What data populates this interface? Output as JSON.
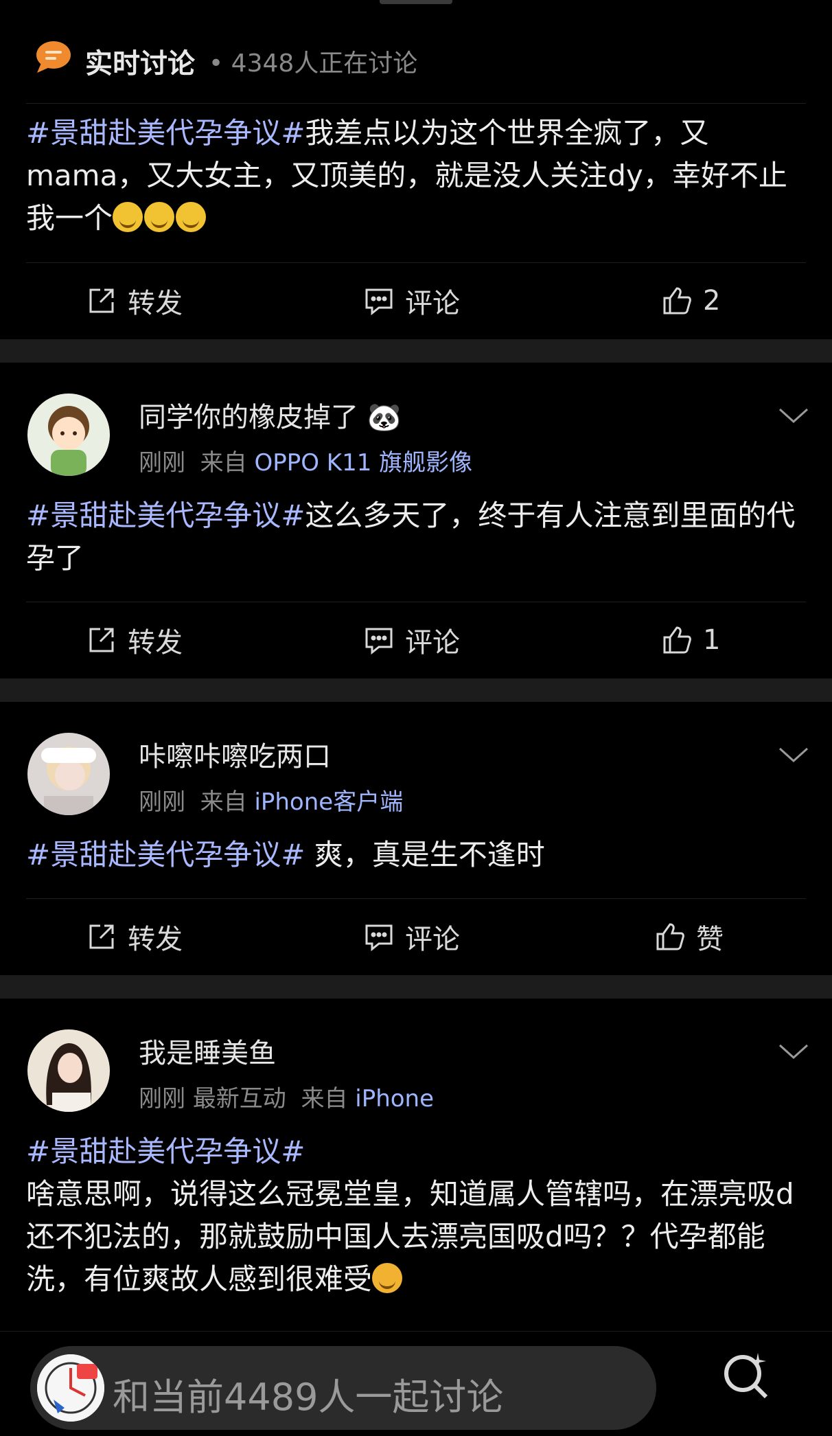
{
  "live": {
    "title": "实时讨论",
    "count_text": "• 4348人正在讨论",
    "icon": "chat-bubble-icon"
  },
  "posts": [
    {
      "body_tag": "#景甜赴美代孕争议#",
      "body_text": "我差点以为这个世界全疯了，又mama，又大女主，又顶美的，就是没人关注dy，幸好不止我一个",
      "emoji_count": 3,
      "actions": {
        "repost": "转发",
        "comment": "评论",
        "like": "2"
      }
    },
    {
      "username": "同学你的橡皮掉了 🐼",
      "time": "刚刚",
      "from_label": "来自",
      "source": "OPPO K11 旗舰影像",
      "body_tag": "#景甜赴美代孕争议#",
      "body_text": "这么多天了，终于有人注意到里面的代孕了",
      "actions": {
        "repost": "转发",
        "comment": "评论",
        "like": "1"
      }
    },
    {
      "username": "咔嚓咔嚓吃两口",
      "time": "刚刚",
      "from_label": "来自",
      "source": "iPhone客户端",
      "body_tag": "#景甜赴美代孕争议#",
      "body_text": " 爽，真是生不逢时",
      "actions": {
        "repost": "转发",
        "comment": "评论",
        "like": "赞"
      }
    },
    {
      "username": "我是睡美鱼",
      "time": "刚刚",
      "extra": "最新互动",
      "from_label": "来自",
      "source": "iPhone",
      "body_tag": "#景甜赴美代孕争议#",
      "body_text": "啥意思啊，说得这么冠冕堂皇，知道属人管辖吗，在漂亮吸d还不犯法的，那就鼓励中国人去漂亮国吸d吗？？代孕都能洗，有位爽故人感到很难受"
    }
  ],
  "composer": {
    "placeholder": "和当前4489人一起讨论",
    "search_icon": "search-sparkle-icon"
  },
  "colors": {
    "background": "#000000",
    "topic_tag": "#a9b8ff",
    "source_link": "#9fb6ff",
    "muted": "#8a8a8a",
    "separator": "#1c1c1c"
  }
}
